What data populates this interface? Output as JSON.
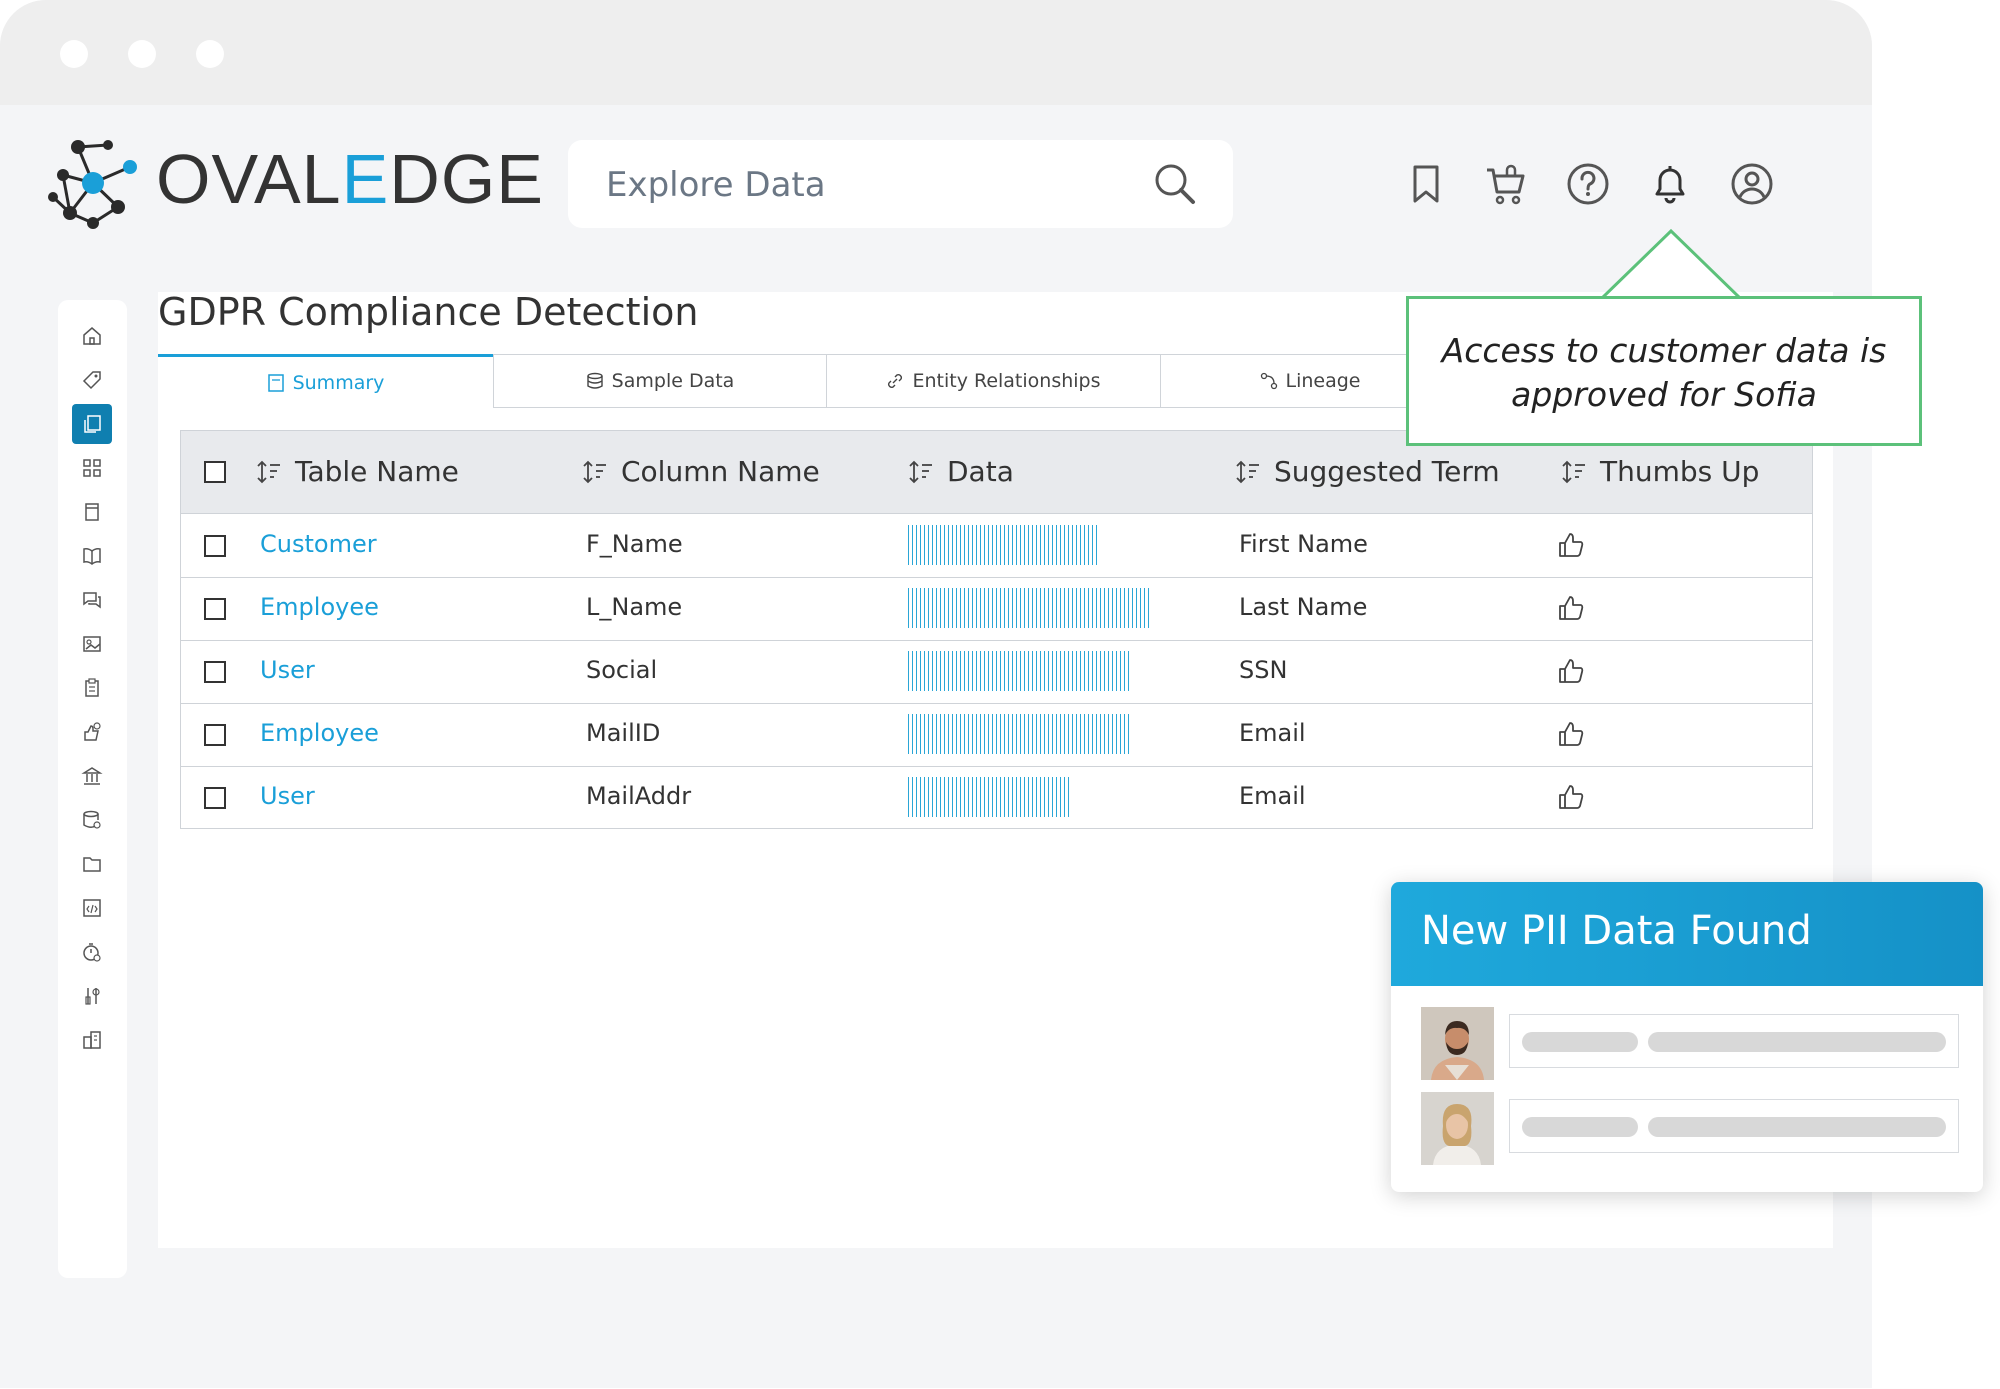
{
  "app": {
    "logo_prefix": "OVAL",
    "logo_accent": "E",
    "logo_suffix": "DGE",
    "brand_color": "#1a9fd8"
  },
  "search": {
    "placeholder": "Explore Data",
    "icon": "search-icon"
  },
  "header_icons": [
    "bookmark-icon",
    "cart-icon",
    "help-icon",
    "bell-icon",
    "user-icon"
  ],
  "sidebar": {
    "items": [
      {
        "icon": "home-icon",
        "active": false
      },
      {
        "icon": "tag-icon",
        "active": false
      },
      {
        "icon": "copy-icon",
        "active": true
      },
      {
        "icon": "grid-icon",
        "active": false
      },
      {
        "icon": "document-icon",
        "active": false
      },
      {
        "icon": "book-icon",
        "active": false
      },
      {
        "icon": "chat-icon",
        "active": false
      },
      {
        "icon": "image-icon",
        "active": false
      },
      {
        "icon": "clipboard-icon",
        "active": false
      },
      {
        "icon": "approval-icon",
        "active": false
      },
      {
        "icon": "bank-icon",
        "active": false
      },
      {
        "icon": "database-icon",
        "active": false
      },
      {
        "icon": "folder-icon",
        "active": false
      },
      {
        "icon": "code-icon",
        "active": false
      },
      {
        "icon": "timer-icon",
        "active": false
      },
      {
        "icon": "tools-icon",
        "active": false
      },
      {
        "icon": "buildings-icon",
        "active": false
      }
    ]
  },
  "page": {
    "title": "GDPR Compliance Detection"
  },
  "tabs": [
    {
      "label": "Summary",
      "icon": "summary-icon",
      "active": true
    },
    {
      "label": "Sample Data",
      "icon": "database-icon",
      "active": false
    },
    {
      "label": "Entity Relationships",
      "icon": "link-icon",
      "active": false
    },
    {
      "label": "Lineage",
      "icon": "lineage-icon",
      "active": false
    }
  ],
  "table": {
    "headers": [
      "Table Name",
      "Column Name",
      "Data",
      "Suggested Term",
      "Thumbs Up"
    ],
    "rows": [
      {
        "table_name": "Customer",
        "column_name": "F_Name",
        "data_fill": 0.6,
        "suggested_term": "First Name"
      },
      {
        "table_name": "Employee",
        "column_name": "L_Name",
        "data_fill": 0.76,
        "suggested_term": "Last Name"
      },
      {
        "table_name": "User",
        "column_name": "Social",
        "data_fill": 0.69,
        "suggested_term": "SSN"
      },
      {
        "table_name": "Employee",
        "column_name": "MailID",
        "data_fill": 0.69,
        "suggested_term": "Email"
      },
      {
        "table_name": "User",
        "column_name": "MailAddr",
        "data_fill": 0.51,
        "suggested_term": "Email"
      }
    ]
  },
  "callout": {
    "line1": "Access to customer data is",
    "line2": "approved for Sofia",
    "border_color": "#5cc17a"
  },
  "pii_card": {
    "title": "New PII Data Found",
    "entries": [
      {
        "avatar": "man-avatar"
      },
      {
        "avatar": "woman-avatar"
      }
    ]
  }
}
